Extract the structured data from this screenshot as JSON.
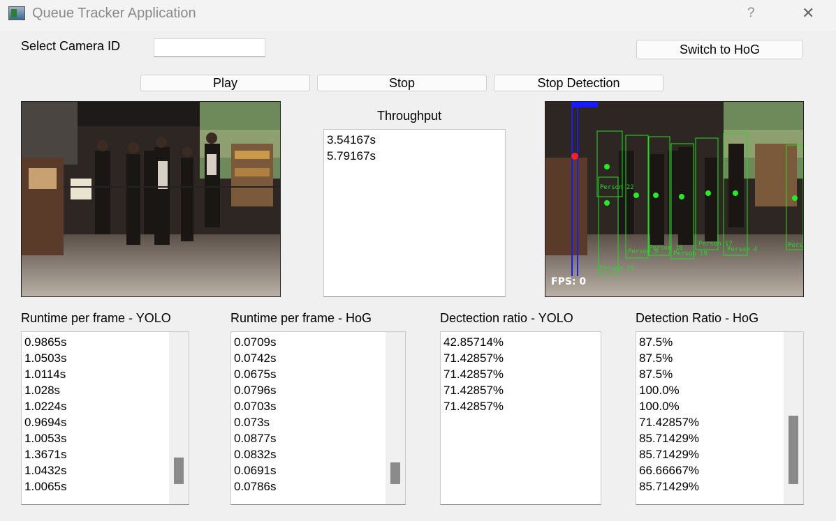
{
  "window": {
    "title": "Queue Tracker Application",
    "help_glyph": "?",
    "close_glyph": "✕"
  },
  "controls": {
    "camera_label": "Select Camera ID",
    "camera_value": "",
    "switch_button": "Switch to HoG",
    "play_button": "Play",
    "stop_button": "Stop",
    "stop_detection_button": "Stop Detection"
  },
  "throughput": {
    "label": "Throughput",
    "items": [
      "3.54167s",
      "5.79167s"
    ]
  },
  "detection_view": {
    "fps_text": "FPS: 0",
    "boxes": [
      "Person 22",
      "Person 18",
      "Person 10",
      "Person 17",
      "Person 4",
      "Person 15",
      "Person 9",
      "Pers"
    ]
  },
  "lists": [
    {
      "title": "Runtime per frame - YOLO",
      "items": [
        "0.9865s",
        "1.0503s",
        "1.0114s",
        "1.028s",
        "1.0224s",
        "0.9694s",
        "1.0053s",
        "1.3671s",
        "1.0432s",
        "1.0065s"
      ],
      "scrollbar": true
    },
    {
      "title": "Runtime per frame - HoG",
      "items": [
        "0.0709s",
        "0.0742s",
        "0.0675s",
        "0.0796s",
        "0.0703s",
        "0.073s",
        "0.0877s",
        "0.0832s",
        "0.0691s",
        "0.0786s"
      ],
      "scrollbar": true
    },
    {
      "title": "Dectection ratio - YOLO",
      "items": [
        "42.85714%",
        "71.42857%",
        "71.42857%",
        "71.42857%",
        "71.42857%"
      ],
      "scrollbar": false
    },
    {
      "title": "Detection Ratio - HoG",
      "items": [
        "87.5%",
        "87.5%",
        "87.5%",
        "100.0%",
        "100.0%",
        "71.42857%",
        "85.71429%",
        "85.71429%",
        "66.66667%",
        "85.71429%"
      ],
      "scrollbar": true
    }
  ],
  "colors": {
    "window_bg": "#f0f0f0",
    "box_green": "#22dd22",
    "tracker_blue": "#1a1aff",
    "marker_red": "#ff2020"
  }
}
